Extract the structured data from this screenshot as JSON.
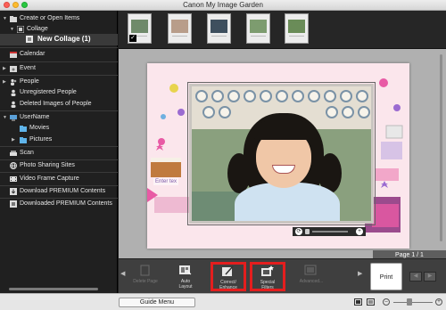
{
  "window": {
    "title": "Canon My Image Garden"
  },
  "sidebar": {
    "items": [
      {
        "label": "Create or Open Items",
        "icon": "folder-icon"
      },
      {
        "label": "Collage",
        "icon": "collage-icon"
      },
      {
        "label": "New Collage (1)",
        "icon": "collage-icon",
        "selected": true
      },
      {
        "label": "Calendar",
        "icon": "calendar-icon"
      },
      {
        "label": "Event",
        "icon": "event-icon"
      },
      {
        "label": "People",
        "icon": "people-icon"
      },
      {
        "label": "Unregistered People",
        "icon": "person-icon"
      },
      {
        "label": "Deleted Images of People",
        "icon": "person-icon"
      },
      {
        "label": "UserName",
        "icon": "computer-icon"
      },
      {
        "label": "Movies",
        "icon": "folder-icon"
      },
      {
        "label": "Pictures",
        "icon": "folder-icon"
      },
      {
        "label": "Scan",
        "icon": "scan-icon"
      },
      {
        "label": "Photo Sharing Sites",
        "icon": "globe-icon"
      },
      {
        "label": "Video Frame Capture",
        "icon": "film-icon"
      },
      {
        "label": "Download PREMIUM Contents",
        "icon": "download-icon"
      },
      {
        "label": "Downloaded PREMIUM Contents",
        "icon": "download-icon"
      }
    ]
  },
  "editor": {
    "enter_text": "Enter tex",
    "page_indicator": "Page 1 / 1"
  },
  "toolbar": {
    "tools": [
      {
        "label": "Delete Page",
        "enabled": false
      },
      {
        "label": "Auto\nLayout",
        "enabled": true
      },
      {
        "label": "Correct/\nEnhance",
        "enabled": true,
        "highlighted": true
      },
      {
        "label": "Special\nFilters",
        "enabled": true,
        "highlighted": true
      },
      {
        "label": "Advanced...",
        "enabled": false
      }
    ],
    "print_label": "Print"
  },
  "status": {
    "guide_menu_label": "Guide Menu"
  },
  "colors": {
    "highlight": "#e41e1e",
    "canvas_bg": "#fbe6ec",
    "sidebar_bg": "#202020"
  }
}
